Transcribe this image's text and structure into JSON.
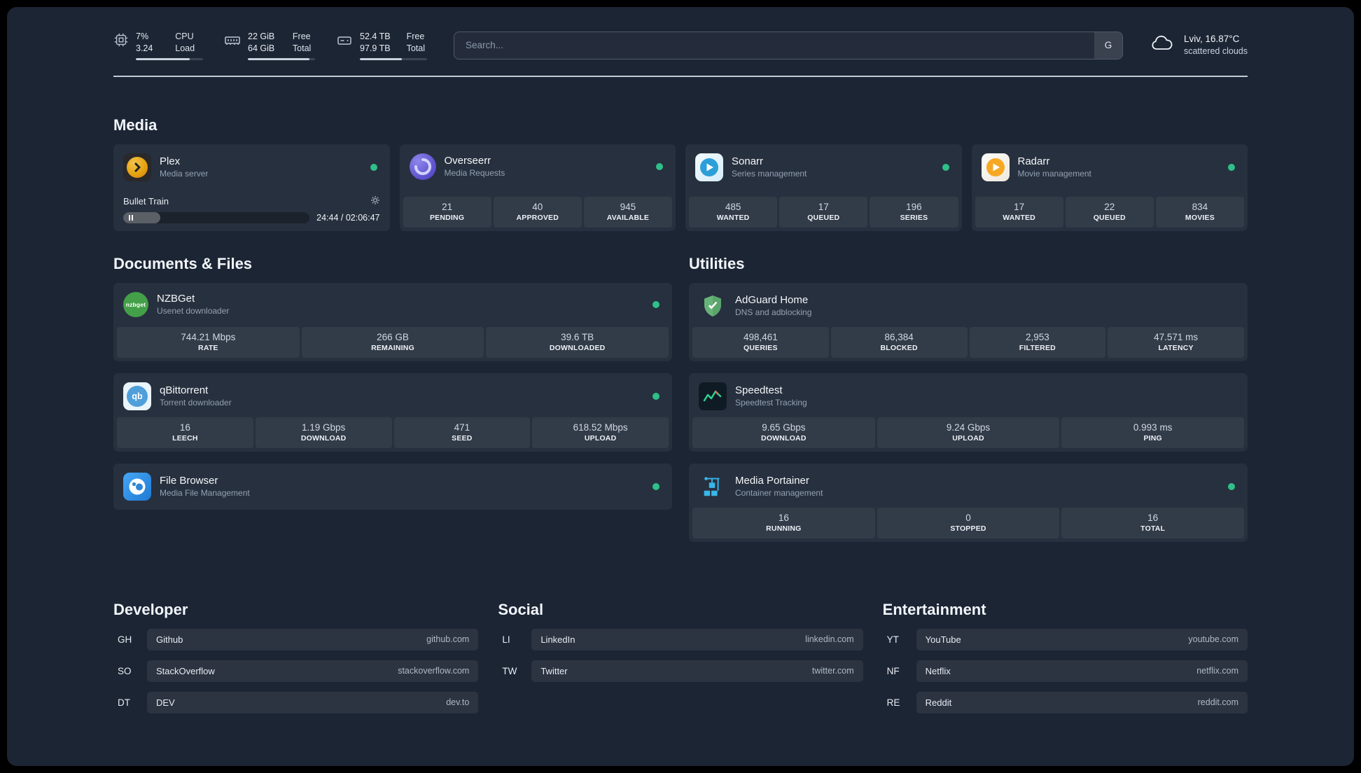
{
  "topbar": {
    "cpu": {
      "value1": "7%",
      "value2": "3.24",
      "label1": "CPU",
      "label2": "Load",
      "pct": 80
    },
    "ram": {
      "value1": "22 GiB",
      "value2": "64 GiB",
      "label1": "Free",
      "label2": "Total",
      "pct": 92
    },
    "disk": {
      "value1": "52.4 TB",
      "value2": "97.9 TB",
      "label1": "Free",
      "label2": "Total",
      "pct": 62
    },
    "search": {
      "placeholder": "Search...",
      "button_label": "G"
    },
    "weather": {
      "location": "Lviv, 16.87°C",
      "condition": "scattered clouds"
    }
  },
  "media": {
    "title": "Media",
    "plex": {
      "name": "Plex",
      "desc": "Media server",
      "now_playing": "Bullet Train",
      "time": "24:44 / 02:06:47",
      "progress_pct": 20
    },
    "overseerr": {
      "name": "Overseerr",
      "desc": "Media Requests",
      "stats": [
        {
          "value": "21",
          "label": "PENDING"
        },
        {
          "value": "40",
          "label": "APPROVED"
        },
        {
          "value": "945",
          "label": "AVAILABLE"
        }
      ]
    },
    "sonarr": {
      "name": "Sonarr",
      "desc": "Series management",
      "stats": [
        {
          "value": "485",
          "label": "WANTED"
        },
        {
          "value": "17",
          "label": "QUEUED"
        },
        {
          "value": "196",
          "label": "SERIES"
        }
      ]
    },
    "radarr": {
      "name": "Radarr",
      "desc": "Movie management",
      "stats": [
        {
          "value": "17",
          "label": "WANTED"
        },
        {
          "value": "22",
          "label": "QUEUED"
        },
        {
          "value": "834",
          "label": "MOVIES"
        }
      ]
    }
  },
  "documents": {
    "title": "Documents & Files",
    "nzbget": {
      "name": "NZBGet",
      "desc": "Usenet downloader",
      "logo_text": "nzbget",
      "stats": [
        {
          "value": "744.21 Mbps",
          "label": "RATE"
        },
        {
          "value": "266 GB",
          "label": "REMAINING"
        },
        {
          "value": "39.6 TB",
          "label": "DOWNLOADED"
        }
      ]
    },
    "qbittorrent": {
      "name": "qBittorrent",
      "desc": "Torrent downloader",
      "logo_text": "qb",
      "stats": [
        {
          "value": "16",
          "label": "LEECH"
        },
        {
          "value": "1.19 Gbps",
          "label": "DOWNLOAD"
        },
        {
          "value": "471",
          "label": "SEED"
        },
        {
          "value": "618.52 Mbps",
          "label": "UPLOAD"
        }
      ]
    },
    "filebrowser": {
      "name": "File Browser",
      "desc": "Media File Management"
    }
  },
  "utilities": {
    "title": "Utilities",
    "adguard": {
      "name": "AdGuard Home",
      "desc": "DNS and adblocking",
      "stats": [
        {
          "value": "498,461",
          "label": "QUERIES"
        },
        {
          "value": "86,384",
          "label": "BLOCKED"
        },
        {
          "value": "2,953",
          "label": "FILTERED"
        },
        {
          "value": "47.571 ms",
          "label": "LATENCY"
        }
      ]
    },
    "speedtest": {
      "name": "Speedtest",
      "desc": "Speedtest Tracking",
      "stats": [
        {
          "value": "9.65 Gbps",
          "label": "DOWNLOAD"
        },
        {
          "value": "9.24 Gbps",
          "label": "UPLOAD"
        },
        {
          "value": "0.993 ms",
          "label": "PING"
        }
      ]
    },
    "portainer": {
      "name": "Media Portainer",
      "desc": "Container management",
      "stats": [
        {
          "value": "16",
          "label": "RUNNING"
        },
        {
          "value": "0",
          "label": "STOPPED"
        },
        {
          "value": "16",
          "label": "TOTAL"
        }
      ]
    }
  },
  "bookmarks": {
    "developer": {
      "title": "Developer",
      "items": [
        {
          "abbr": "GH",
          "name": "Github",
          "url": "github.com"
        },
        {
          "abbr": "SO",
          "name": "StackOverflow",
          "url": "stackoverflow.com"
        },
        {
          "abbr": "DT",
          "name": "DEV",
          "url": "dev.to"
        }
      ]
    },
    "social": {
      "title": "Social",
      "items": [
        {
          "abbr": "LI",
          "name": "LinkedIn",
          "url": "linkedin.com"
        },
        {
          "abbr": "TW",
          "name": "Twitter",
          "url": "twitter.com"
        }
      ]
    },
    "entertainment": {
      "title": "Entertainment",
      "items": [
        {
          "abbr": "YT",
          "name": "YouTube",
          "url": "youtube.com"
        },
        {
          "abbr": "NF",
          "name": "Netflix",
          "url": "netflix.com"
        },
        {
          "abbr": "RE",
          "name": "Reddit",
          "url": "reddit.com"
        }
      ]
    }
  }
}
